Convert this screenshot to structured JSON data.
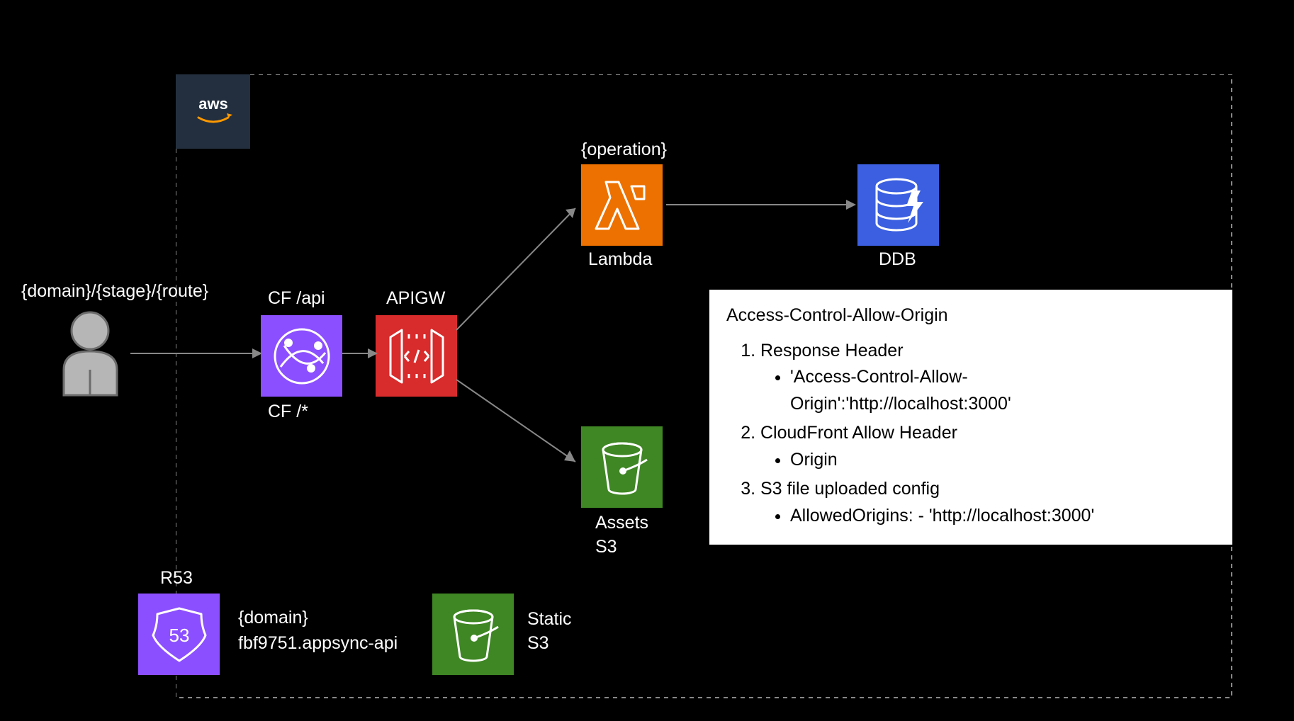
{
  "labels": {
    "userRoute": "{domain}/{stage}/{route}",
    "lambdaTop": "{operation}",
    "lambdaName": "Lambda",
    "cfApi": "CF /api",
    "apigw": "APIGW",
    "cfDefault": "CF /*",
    "s3Assets": "Assets\nS3",
    "ddb": "DDB",
    "r53": "R53",
    "r53Line1": "{domain}",
    "r53Line2": "fbf9751.appsync-api",
    "staticS3": "Static\nS3"
  },
  "note": {
    "title": "Access-Control-Allow-Origin",
    "items": [
      {
        "text": "Response Header",
        "sub": [
          "'Access-Control-Allow-Origin':'http://localhost:3000'"
        ]
      },
      {
        "text": "CloudFront Allow Header",
        "sub": [
          "Origin"
        ]
      },
      {
        "text": "S3 file uploaded config",
        "sub": [
          "AllowedOrigins: - 'http://localhost:3000'"
        ]
      }
    ]
  }
}
